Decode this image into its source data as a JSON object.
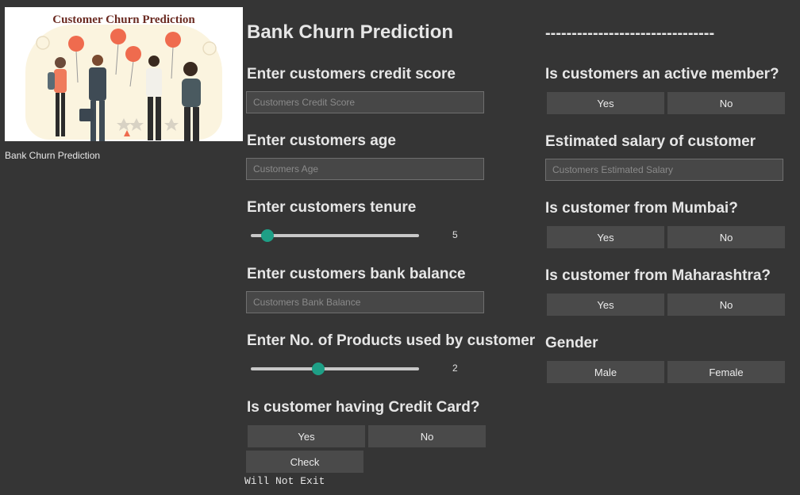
{
  "sidebar": {
    "image_title": "Customer Churn Prediction",
    "caption": "Bank Churn Prediction"
  },
  "title": "Bank Churn Prediction",
  "separator": "--------------------------------",
  "left": {
    "credit_score": {
      "label": "Enter customers credit score",
      "placeholder": "Customers Credit Score"
    },
    "age": {
      "label": "Enter customers age",
      "placeholder": "Customers Age"
    },
    "tenure": {
      "label": "Enter customers tenure",
      "value": "5",
      "fraction": 0.1
    },
    "balance": {
      "label": "Enter customers bank balance",
      "placeholder": "Customers Bank Balance"
    },
    "products": {
      "label": "Enter No. of Products used by customer",
      "value": "2",
      "fraction": 0.4
    },
    "credit_card": {
      "label": "Is customer having Credit Card?",
      "yes": "Yes",
      "no": "No"
    },
    "check_button": "Check",
    "result": "Will Not Exit"
  },
  "right": {
    "active_member": {
      "label": "Is customers an active member?",
      "yes": "Yes",
      "no": "No"
    },
    "salary": {
      "label": "Estimated salary of customer",
      "placeholder": "Customers Estimated Salary"
    },
    "mumbai": {
      "label": "Is customer from Mumbai?",
      "yes": "Yes",
      "no": "No"
    },
    "maharashtra": {
      "label": "Is customer from Maharashtra?",
      "yes": "Yes",
      "no": "No"
    },
    "gender": {
      "label": "Gender",
      "male": "Male",
      "female": "Female"
    }
  },
  "colors": {
    "background": "#353535",
    "button": "#4a4a4a",
    "slider_thumb": "#1e9f86"
  }
}
